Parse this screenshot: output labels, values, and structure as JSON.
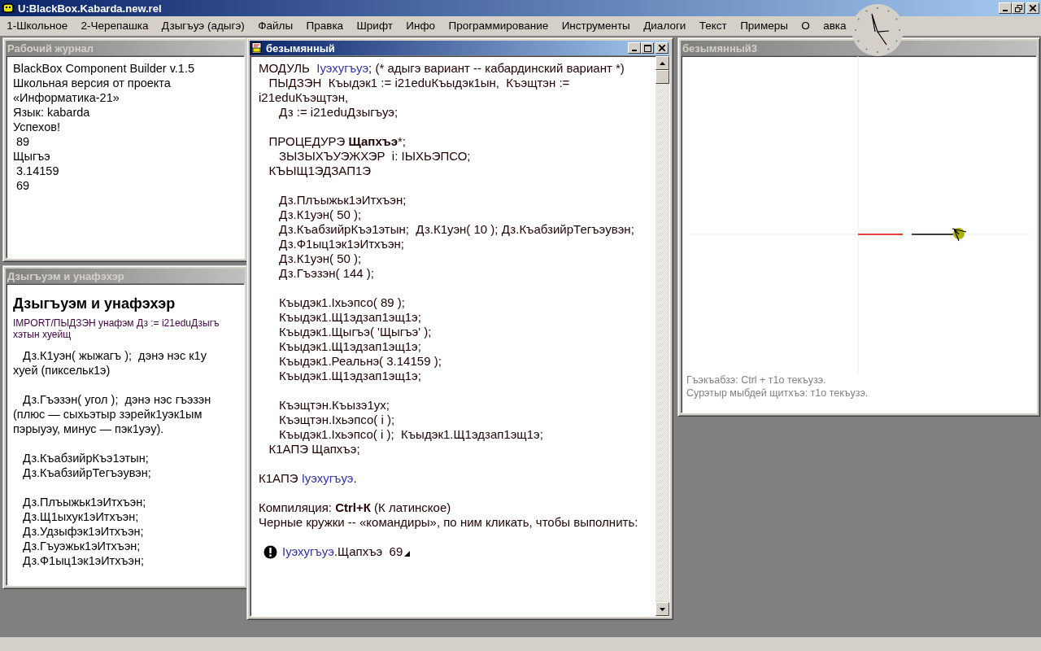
{
  "app": {
    "title": "U:BlackBox.Kabarda.new.rel"
  },
  "menu": [
    "1-Школьное",
    "2-Черепашка",
    "Дзыгъуэ (адыгэ)",
    "Файлы",
    "Правка",
    "Шрифт",
    "Инфо",
    "Программирование",
    "Инструменты",
    "Диалоги",
    "Текст",
    "Примеры",
    "О",
    "авка"
  ],
  "windows": [
    {
      "kind": "log",
      "title": "Рабочий журнал",
      "active": false,
      "lines": [
        "BlackBox Component Builder v.1.5",
        "Школьная версия от проекта",
        "«Информатика-21»",
        "Язык: kabarda",
        "Успехов!",
        " 89",
        "Щыгъэ",
        " 3.14159",
        " 69"
      ]
    },
    {
      "kind": "doc",
      "title": "Дзыгъуэм и унафэхэр",
      "active": false,
      "heading": "Дзыгъуэм и унафэхэр",
      "note_lines": [
        "IMPORT/ПЫДЗЭН унафэм Дз := i21eduДзыгъ",
        "хэтын хуейщ"
      ],
      "paragraphs": [
        [
          "   Дз.К1уэн( жыжагъ );  дэнэ нэс к1у",
          "хуей (пиксельк1э)"
        ],
        [
          "   Дз.Гъэзэн( угол );  дэнэ нэс гъэзэн",
          "(плюс — сыхьэтыр зэрейк1уэк1ым",
          "пэрыуэу, минус — пэк1уэу)."
        ],
        [
          "   Дз.КъабзийрКъэ1этын;",
          "   Дз.КъабзийрТегъэувэн;"
        ],
        [
          "   Дз.Плъыжьк1эИтхъэн;",
          "   Дз.Щ1ыхук1эИтхъэн;",
          "   Дз.Удзыфэк1эИтхъэн;",
          "   Дз.Гъуэжьк1эИтхъэн;",
          "   Дз.Ф1ыц1эк1эИтхъэн;"
        ]
      ]
    },
    {
      "kind": "editor",
      "title": "безымянный",
      "active": true,
      "blocks": [
        [
          [
            {
              "kind": "plain",
              "text": "МОДУЛЬ  "
            },
            {
              "kind": "name",
              "text": "Iуэхугъуэ"
            },
            {
              "kind": "plain",
              "text": "; (* адыгэ вариант -- кабардинский вариант *)"
            }
          ],
          [
            {
              "kind": "plain",
              "text": "   ПЫДЗЭН  Къыдэк1 := i21eduКъыдэк1ын,  Къэщтэн := i21eduКъэщтэн,"
            }
          ],
          [
            {
              "kind": "plain",
              "text": "      Дз := i21eduДзыгъуэ;"
            }
          ]
        ],
        [
          [
            {
              "kind": "plain",
              "text": "   ПРОЦЕДУРЭ "
            },
            {
              "kind": "bold",
              "text": "Щапхъэ"
            },
            {
              "kind": "plain",
              "text": "*;"
            }
          ],
          [
            {
              "kind": "plain",
              "text": "      ЗЫЗЫХЪУЭЖХЭР  i: IЫХЬЭПСО;"
            }
          ],
          [
            {
              "kind": "plain",
              "text": "   КЪЫЩ1ЭДЗАП1Э"
            }
          ]
        ],
        [
          [
            {
              "kind": "plain",
              "text": "      Дз.Плъыжьк1эИтхъэн;"
            }
          ],
          [
            {
              "kind": "plain",
              "text": "      Дз.К1уэн( 50 );"
            }
          ],
          [
            {
              "kind": "plain",
              "text": "      Дз.КъабзийрКъэ1этын;  Дз.К1уэн( 10 ); Дз.КъабзийрТегъэувэн;"
            }
          ],
          [
            {
              "kind": "plain",
              "text": "      Дз.Ф1ыц1эк1эИтхъэн;"
            }
          ],
          [
            {
              "kind": "plain",
              "text": "      Дз.К1уэн( 50 );"
            }
          ],
          [
            {
              "kind": "plain",
              "text": "      Дз.Гъэзэн( 144 );"
            }
          ]
        ],
        [
          [
            {
              "kind": "plain",
              "text": "      Къыдэк1.Iхьэпсо( 89 );"
            }
          ],
          [
            {
              "kind": "plain",
              "text": "      Къыдэк1.Щ1эдзап1эщ1э;"
            }
          ],
          [
            {
              "kind": "plain",
              "text": "      Къыдэк1.Щыгъэ( 'Щыгъэ' );"
            }
          ],
          [
            {
              "kind": "plain",
              "text": "      Къыдэк1.Щ1эдзап1эщ1э;"
            }
          ],
          [
            {
              "kind": "plain",
              "text": "      Къыдэк1.Реальнэ( 3.14159 );"
            }
          ],
          [
            {
              "kind": "plain",
              "text": "      Къыдэк1.Щ1эдзап1эщ1э;"
            }
          ]
        ],
        [
          [
            {
              "kind": "plain",
              "text": "      Къэщтэн.Къызэ1ух;"
            }
          ],
          [
            {
              "kind": "plain",
              "text": "      Къэщтэн.Iхьэпсо( i );"
            }
          ],
          [
            {
              "kind": "plain",
              "text": "      Къыдэк1.Iхьэпсо( i );  Къыдэк1.Щ1эдзап1эщ1э;"
            }
          ],
          [
            {
              "kind": "plain",
              "text": "   К1АПЭ Щапхъэ;"
            }
          ]
        ],
        [
          [
            {
              "kind": "plain",
              "text": "К1АПЭ "
            },
            {
              "kind": "name",
              "text": "Iуэхугъуэ"
            },
            {
              "kind": "plain",
              "text": "."
            }
          ]
        ],
        [
          [
            {
              "kind": "plain",
              "text": "Компиляция: "
            },
            {
              "kind": "bold",
              "text": "Ctrl+К"
            },
            {
              "kind": "plain",
              "text": " (К латинское)"
            }
          ],
          [
            {
              "kind": "plain",
              "text": "Черные кружки -- «командиры», по ним кликать, чтобы выполнить:"
            }
          ]
        ]
      ],
      "commander": {
        "module": "Iуэхугъуэ",
        "rest": ".Щапхъэ  69"
      }
    },
    {
      "kind": "canvas",
      "title": "безымянный3",
      "active": false,
      "hints": [
        "Гъэкъабзэ: Ctrl + т1о текъузэ.",
        "Сурэтыр мыбдей щитхъэ: т1о текъузэ."
      ]
    }
  ]
}
